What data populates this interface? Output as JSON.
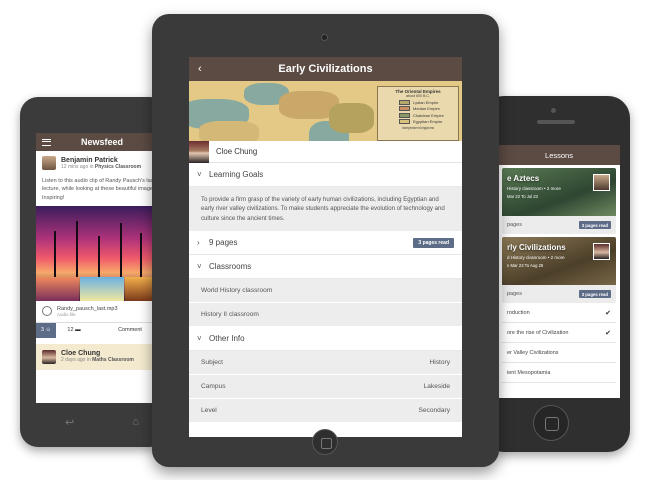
{
  "newsfeed": {
    "title": "Newsfeed",
    "post": {
      "author": "Benjamin Patrick",
      "time": "12 mins ago in",
      "place": "Physics Classroom",
      "text": "Listen to this audio clip of Randy Pausch's last lecture, while looking at these beautiful images. Inspiring!",
      "audio_name": "Randy_pausch_last.mp3",
      "audio_label": "Audio file",
      "likes": "3",
      "comments": "12",
      "comment_label": "Comment"
    },
    "post2": {
      "author": "Cloe Chung",
      "time": "2 days ago in",
      "place": "Maths Classroom"
    }
  },
  "lessons": {
    "title": "Lessons",
    "cards": [
      {
        "title": "e Aztecs",
        "sub": "History classroom • 2 more",
        "date": "Mar 22 To Jul 23",
        "pages": "pages",
        "badge": "3 pages read"
      },
      {
        "title": "rly Civilizations",
        "sub": "d History classroom • 2 more",
        "date": "n Mar 23 To Aug 26",
        "pages": "pages",
        "badge": "3 pages read"
      }
    ],
    "items": [
      {
        "label": "roduction",
        "done": "✔"
      },
      {
        "label": "ore the rise of Civilization",
        "done": "✔"
      },
      {
        "label": "er Valley Civilizations",
        "done": ""
      },
      {
        "label": "ient Mesopotamia",
        "done": ""
      }
    ]
  },
  "course": {
    "title": "Early Civilizations",
    "map": {
      "title": "The Oriental Empires",
      "subtitle": "about 600 B.C.",
      "legend": [
        "Lydian Empire",
        "Median Empire",
        "Chaldean Empire",
        "Egyptian Empire"
      ],
      "legend_colors": [
        "#b7a96a",
        "#c98f63",
        "#8a9a66",
        "#d9c37a"
      ],
      "footer": "Independent kingdoms"
    },
    "teacher": "Cloe Chung",
    "learning_goals_label": "Learning Goals",
    "learning_goals_text": "To provide a firm grasp of the variety of early human civilizations, including Egyptian and early river valley civilizations. To make students appreciate the evolution of technology and culture since the ancient times.",
    "pages_label": "9 pages",
    "pages_badge": "3 pages read",
    "classrooms_label": "Classrooms",
    "classrooms": [
      "World History classroom",
      "History II classroom"
    ],
    "other_info_label": "Other Info",
    "info": [
      {
        "key": "Subject",
        "value": "History"
      },
      {
        "key": "Campus",
        "value": "Lakeside"
      },
      {
        "key": "Level",
        "value": "Secondary"
      }
    ]
  },
  "colors": {
    "header": "#5b4b43",
    "badge": "#5d6d88"
  }
}
